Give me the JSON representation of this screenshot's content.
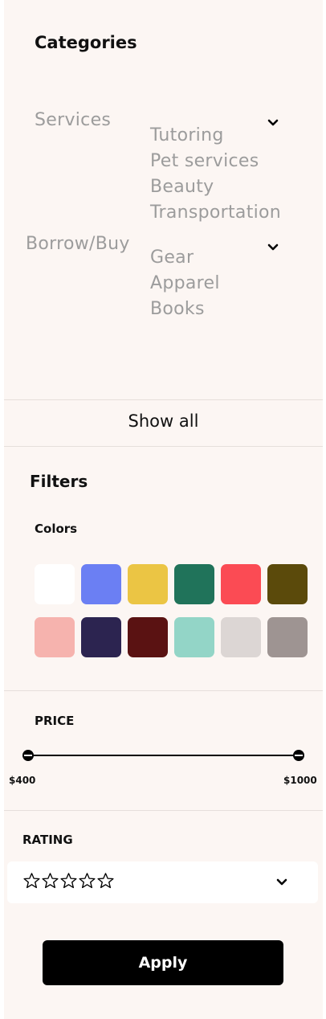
{
  "categories": {
    "title": "Categories",
    "groups": [
      {
        "label": "Services",
        "items": [
          "Tutoring",
          "Pet services",
          "Beauty",
          "Transportation"
        ]
      },
      {
        "label": "Borrow/Buy",
        "items": [
          "Gear",
          "Apparel",
          "Books"
        ]
      }
    ],
    "show_all": "Show all"
  },
  "filters": {
    "title": "Filters",
    "colors_label": "Colors",
    "colors": [
      [
        "#ffffff",
        "#6b7ff3",
        "#ebc544",
        "#20735a",
        "#fb4b54",
        "#5b4a0b"
      ],
      [
        "#f6b3ae",
        "#2c2450",
        "#5a1212",
        "#93d5c7",
        "#dcd6d4",
        "#9e9492"
      ]
    ],
    "price": {
      "label": "PRICE",
      "min": "$400",
      "max": "$1000"
    },
    "rating": {
      "label": "RATING",
      "stars": 5,
      "filled": 0
    }
  },
  "apply_label": "Apply"
}
